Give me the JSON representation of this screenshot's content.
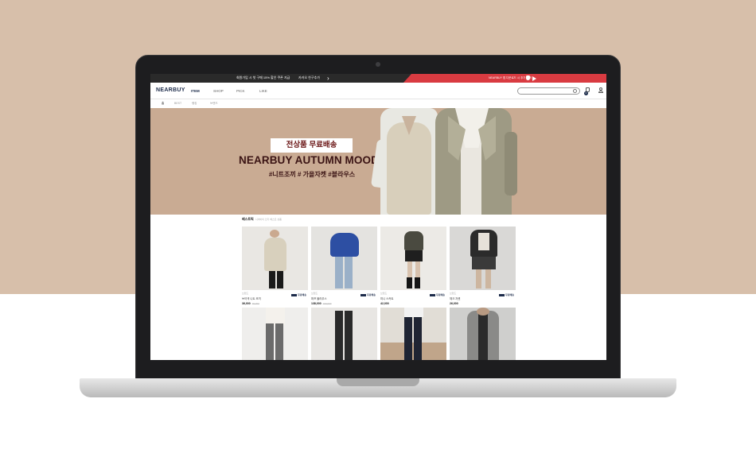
{
  "topbar": {
    "promo_text": "회원가입 시 첫 구매 15% 할인 쿠폰 지급",
    "tag_text": "카카오 친구추가",
    "app_text": "NEARBUY 앱 다운로드 시 추가 혜택",
    "colors": {
      "dark": "#2a2a2a",
      "accent": "#d93b41"
    }
  },
  "nav": {
    "logo": "NEARBUY",
    "items": [
      {
        "label": "ITEM",
        "active": true
      },
      {
        "label": "SHOP",
        "active": false
      },
      {
        "label": "PICK",
        "active": false
      },
      {
        "label": "LIKE",
        "active": false
      }
    ],
    "search_placeholder": "",
    "cart_count": "0"
  },
  "subnav": {
    "items": [
      {
        "label": "홈",
        "active": true
      },
      {
        "label": "BEST",
        "active": false
      },
      {
        "label": "랭킹",
        "active": false
      },
      {
        "label": "브랜드",
        "active": false
      }
    ]
  },
  "hero": {
    "badge": "전상품 무료배송",
    "title": "NEARBUY AUTUMN MOOD",
    "tags": "#니트조끼 # 가을자켓 #블라우스",
    "background": "#c9ab93"
  },
  "best": {
    "title": "베스트픽",
    "subtitle": "니어바이 인기 베스트 상품",
    "shipping_label": "무료배송",
    "products": [
      {
        "brand": "브랜드",
        "name": "브이넥 니트 조끼",
        "price": "36,000",
        "orig": "45,000"
      },
      {
        "brand": "브랜드",
        "name": "퍼프 블라우스",
        "price": "138,000",
        "orig": "160,000"
      },
      {
        "brand": "브랜드",
        "name": "미니 스커트",
        "price": "42,000",
        "orig": ""
      },
      {
        "brand": "브랜드",
        "name": "체크 자켓",
        "price": "26,000",
        "orig": ""
      },
      {
        "brand": "브랜드",
        "name": "",
        "price": "",
        "orig": ""
      },
      {
        "brand": "브랜드",
        "name": "",
        "price": "",
        "orig": ""
      },
      {
        "brand": "브랜드",
        "name": "",
        "price": "",
        "orig": ""
      },
      {
        "brand": "브랜드",
        "name": "",
        "price": "",
        "orig": ""
      }
    ]
  }
}
